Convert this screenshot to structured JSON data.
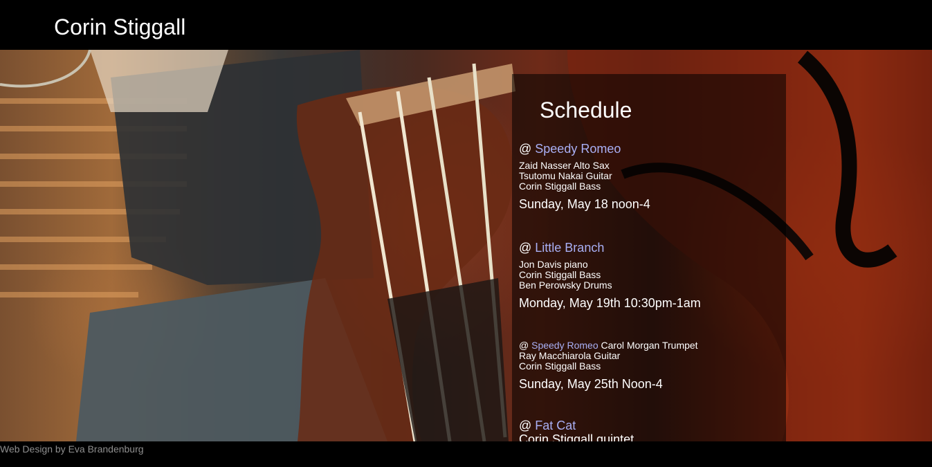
{
  "header": {
    "site_title": "Corin Stiggall"
  },
  "schedule": {
    "title": "Schedule",
    "venue_prefix": "@ ",
    "gigs": [
      {
        "venue": "Speedy Romeo",
        "players": [
          "Zaid Nasser Alto Sax",
          "Tsutomu Nakai Guitar",
          "Corin Stiggall Bass"
        ],
        "when": "Sunday, May 18 noon-4"
      },
      {
        "venue": "Little Branch",
        "players": [
          "Jon Davis piano",
          "Corin Stiggall Bass",
          "Ben Perowsky Drums"
        ],
        "when": "Monday, May 19th 10:30pm-1am"
      },
      {
        "venue": "Speedy Romeo",
        "venue_suffix": " Carol Morgan Trumpet",
        "players": [
          "Ray Macchiarola Guitar",
          "Corin Stiggall Bass"
        ],
        "when": "Sunday, May 25th Noon-4"
      },
      {
        "venue": "Fat Cat",
        "players": [
          "Corin Stiggall quintet"
        ]
      }
    ]
  },
  "footer": {
    "credit": "Web Design by Eva Brandenburg"
  },
  "colors": {
    "link": "#a9b0f5",
    "panel": "rgba(0,0,0,0.55)",
    "credit": "#8f8f8f"
  }
}
